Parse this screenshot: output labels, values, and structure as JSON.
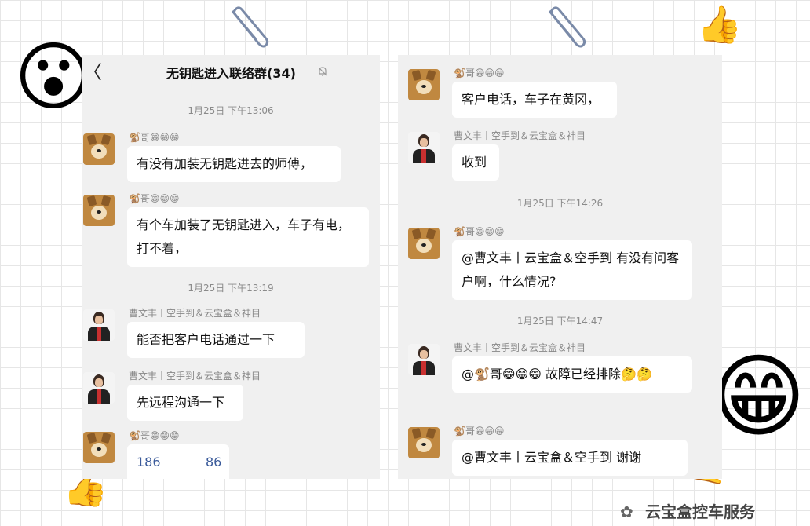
{
  "header": {
    "title": "无钥匙进入联络群(34)",
    "back_glyph": "〈",
    "more_glyph": "···"
  },
  "left_chat": {
    "ts1": "1月25日 下午13:06",
    "ts2": "1月25日 下午13:19",
    "messages": [
      {
        "sender": "🐒哥😁😁😁",
        "text": "有没有加装无钥匙进去的师傅，",
        "avatar": "dog-avatar"
      },
      {
        "sender": "🐒哥😁😁😁",
        "text": "有个车加装了无钥匙进入，车子有电，打不着，",
        "avatar": "dog-avatar"
      },
      {
        "sender": "曹文丰丨空手到＆云宝盒＆神目",
        "text": "能否把客户电话通过一下",
        "avatar": "person-avatar"
      },
      {
        "sender": "曹文丰丨空手到＆云宝盒＆神目",
        "text": "先远程沟通一下",
        "avatar": "person-avatar"
      },
      {
        "sender": "🐒哥😁😁😁",
        "text_a": "186",
        "text_b": "86",
        "avatar": "dog-avatar"
      }
    ]
  },
  "right_chat": {
    "ts1": "1月25日 下午14:26",
    "ts2": "1月25日 下午14:47",
    "messages": [
      {
        "sender": "🐒哥😁😁😁",
        "text": "客户电话，车子在黄冈，",
        "avatar": "dog-avatar"
      },
      {
        "sender": "曹文丰丨空手到＆云宝盒＆神目",
        "text": "收到",
        "avatar": "person-avatar"
      },
      {
        "sender": "🐒哥😁😁😁",
        "text": "@曹文丰丨云宝盒＆空手到  有没有问客户啊，什么情况?",
        "avatar": "dog-avatar"
      },
      {
        "sender": "曹文丰丨空手到＆云宝盒＆神目",
        "text": "@🐒哥😁😁😁  故障已经排除🤔🤔",
        "avatar": "person-avatar"
      },
      {
        "sender": "🐒哥😁😁😁",
        "text": "@曹文丰丨云宝盒＆空手到  谢谢",
        "avatar": "dog-avatar"
      }
    ]
  },
  "stickers": {
    "thumbs_top": "👍",
    "thumbs_bottom_left": "👍",
    "hand_right": "🤙",
    "face_left": "😮",
    "face_right": "😁"
  },
  "watermark": {
    "text": "云宝盒控车服务",
    "icon": "wechat-icon"
  }
}
